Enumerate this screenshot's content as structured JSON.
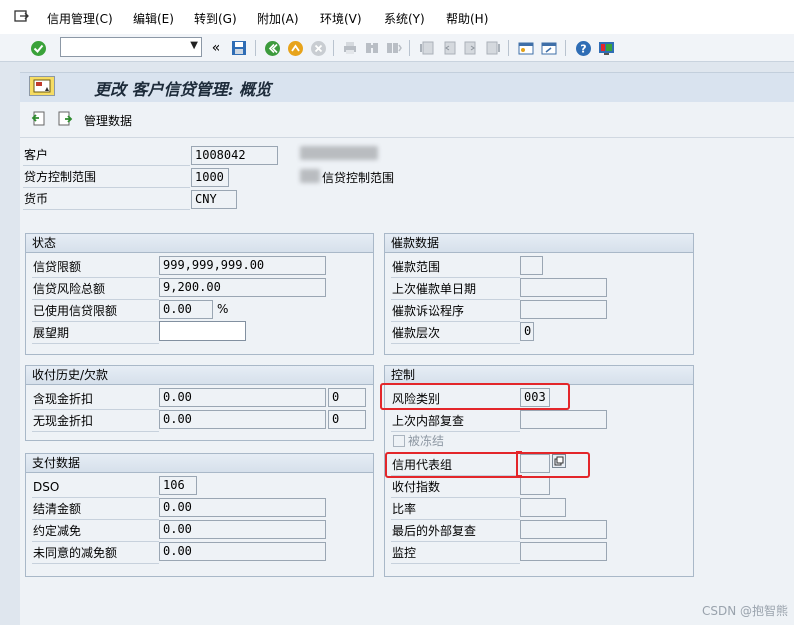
{
  "menu": [
    "信用管理(C)",
    "编辑(E)",
    "转到(G)",
    "附加(A)",
    "环境(V)",
    "系统(Y)",
    "帮助(H)"
  ],
  "toolbar": {
    "command_value": ""
  },
  "header": {
    "title": "更改 客户信贷管理: 概览"
  },
  "app_toolbar": {
    "manage_data_label": "管理数据"
  },
  "top": {
    "customer_label": "客户",
    "customer_value": "1008042",
    "credit_area_label": "贷方控制范围",
    "credit_area_value": "1000",
    "credit_area_desc": "信贷控制范围",
    "currency_label": "货币",
    "currency_value": "CNY"
  },
  "status": {
    "title": "状态",
    "credit_limit_label": "信贷限额",
    "credit_limit_value": "999,999,999.00",
    "credit_exposure_label": "信贷风险总额",
    "credit_exposure_value": "9,200.00",
    "used_label": "已使用信贷限额",
    "used_value": "0.00",
    "used_unit": "%",
    "horizon_label": "展望期",
    "horizon_value": ""
  },
  "dunning": {
    "title": "催款数据",
    "area_label": "催款范围",
    "area_value": "",
    "last_notice_label": "上次催款单日期",
    "last_notice_value": "",
    "legal_label": "催款诉讼程序",
    "legal_value": "",
    "level_label": "催款层次",
    "level_value": "0"
  },
  "payment_history": {
    "title": "收付历史/欠款",
    "with_discount_label": "含现金折扣",
    "with_discount_value": "0.00",
    "with_discount_count": "0",
    "without_discount_label": "无现金折扣",
    "without_discount_value": "0.00",
    "without_discount_count": "0"
  },
  "control": {
    "title": "控制",
    "risk_label": "风险类别",
    "risk_value": "003",
    "last_internal_label": "上次内部复查",
    "last_internal_value": "",
    "blocked_label": "被冻结",
    "rep_group_label": "信用代表组",
    "rep_group_value": "",
    "pay_index_label": "收付指数",
    "pay_index_value": "",
    "rating_label": "比率",
    "rating_value": "",
    "last_external_label": "最后的外部复查",
    "last_external_value": "",
    "monitor_label": "监控",
    "monitor_value": ""
  },
  "payment_data": {
    "title": "支付数据",
    "dso_label": "DSO",
    "dso_value": "106",
    "cleared_label": "结清金额",
    "cleared_value": "0.00",
    "agreed_label": "约定减免",
    "agreed_value": "0.00",
    "disputed_label": "未同意的减免额",
    "disputed_value": "0.00"
  },
  "watermark": "CSDN @抱智熊"
}
